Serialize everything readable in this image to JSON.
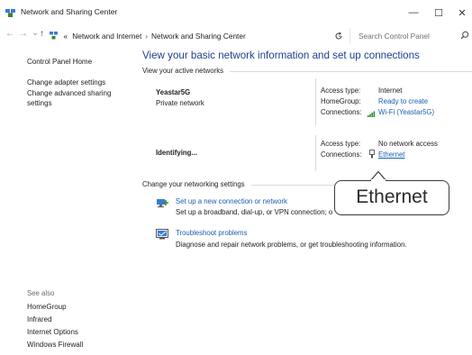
{
  "window": {
    "title": "Network and Sharing Center",
    "minimize": "—",
    "maximize": "☐",
    "close": "✕"
  },
  "addressbar": {
    "back": "←",
    "forward": "→",
    "recent": "⌄",
    "up": "↑",
    "overflow": "«",
    "crumbs": [
      "Network and Internet",
      "Network and Sharing Center"
    ],
    "separator": "›",
    "search_placeholder": "Search Control Panel"
  },
  "sidebar": {
    "home": "Control Panel Home",
    "links": [
      "Change adapter settings",
      "Change advanced sharing",
      "settings"
    ],
    "see_also_label": "See also",
    "see_also": [
      "HomeGroup",
      "Infrared",
      "Internet Options",
      "Windows Firewall"
    ]
  },
  "main": {
    "heading": "View your basic network information and set up connections",
    "active_networks_label": "View your active networks",
    "networks": [
      {
        "name": "Yeastar5G",
        "category": "Private network",
        "access_label": "Access type:",
        "access_value": "Internet",
        "homegroup_label": "HomeGroup:",
        "homegroup_value": "Ready to create",
        "connections_label": "Connections:",
        "connections_value": "Wi-Fi (Yeastar5G)"
      },
      {
        "name": "Identifying...",
        "access_label": "Access type:",
        "access_value": "No network access",
        "connections_label": "Connections:",
        "connections_value": "Ethernet"
      }
    ],
    "settings_label": "Change your networking settings",
    "tasks": [
      {
        "title": "Set up a new connection or network",
        "desc": "Set up a broadband, dial-up, or VPN connection; o"
      },
      {
        "title": "Troubleshoot problems",
        "desc": "Diagnose and repair network problems, or get troubleshooting information."
      }
    ]
  },
  "callout": {
    "text": "Ethernet"
  },
  "colors": {
    "heading": "#1f3f8f",
    "link": "#1a5fb4",
    "wifi": "#2e8b2e"
  }
}
